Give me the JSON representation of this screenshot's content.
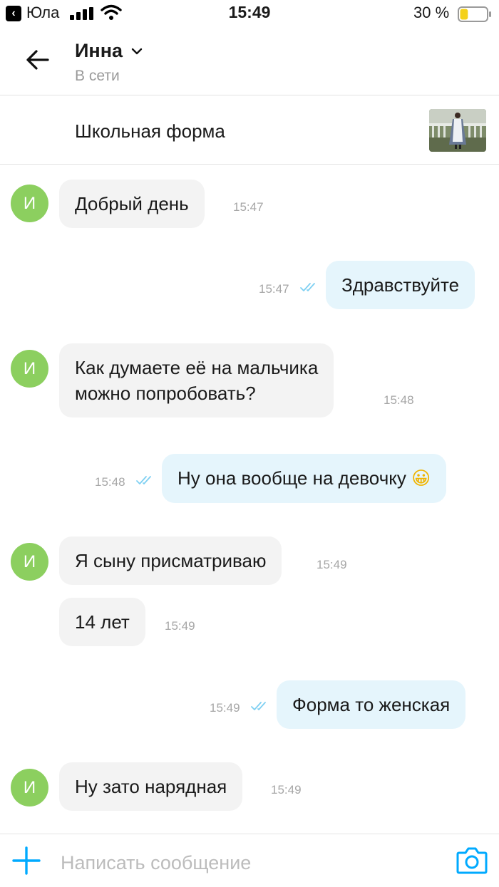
{
  "status_bar": {
    "carrier": "Юла",
    "time": "15:49",
    "battery_percent": "30 %",
    "battery_level": 0.3
  },
  "header": {
    "contact_name": "Инна",
    "contact_status": "В сети"
  },
  "listing": {
    "title": "Школьная форма"
  },
  "messages": [
    {
      "direction": "in",
      "avatar_letter": "И",
      "text": "Добрый день",
      "time": "15:47"
    },
    {
      "direction": "out",
      "text": "Здравствуйте",
      "time": "15:47",
      "read": true
    },
    {
      "direction": "in",
      "avatar_letter": "И",
      "text_lines": [
        "Как думаете её на мальчика",
        "можно попробовать?"
      ],
      "time": "15:48"
    },
    {
      "direction": "out",
      "text": "Ну она вообще на девочку",
      "emoji": "😀",
      "time": "15:48",
      "read": true
    },
    {
      "direction": "in",
      "avatar_letter": "И",
      "text": "Я сыну присматриваю",
      "time": "15:49"
    },
    {
      "direction": "in",
      "text": "14 лет",
      "time": "15:49"
    },
    {
      "direction": "out",
      "text": "Форма то женская",
      "time": "15:49",
      "read": true
    },
    {
      "direction": "in",
      "avatar_letter": "И",
      "text": "Ну зато нарядная",
      "time": "15:49"
    }
  ],
  "composer": {
    "placeholder": "Написать сообщение"
  },
  "colors": {
    "avatar": "#8ccf5f",
    "accent": "#00aaff",
    "incoming_bubble": "#f3f3f3",
    "outgoing_bubble": "#e5f5fc"
  }
}
